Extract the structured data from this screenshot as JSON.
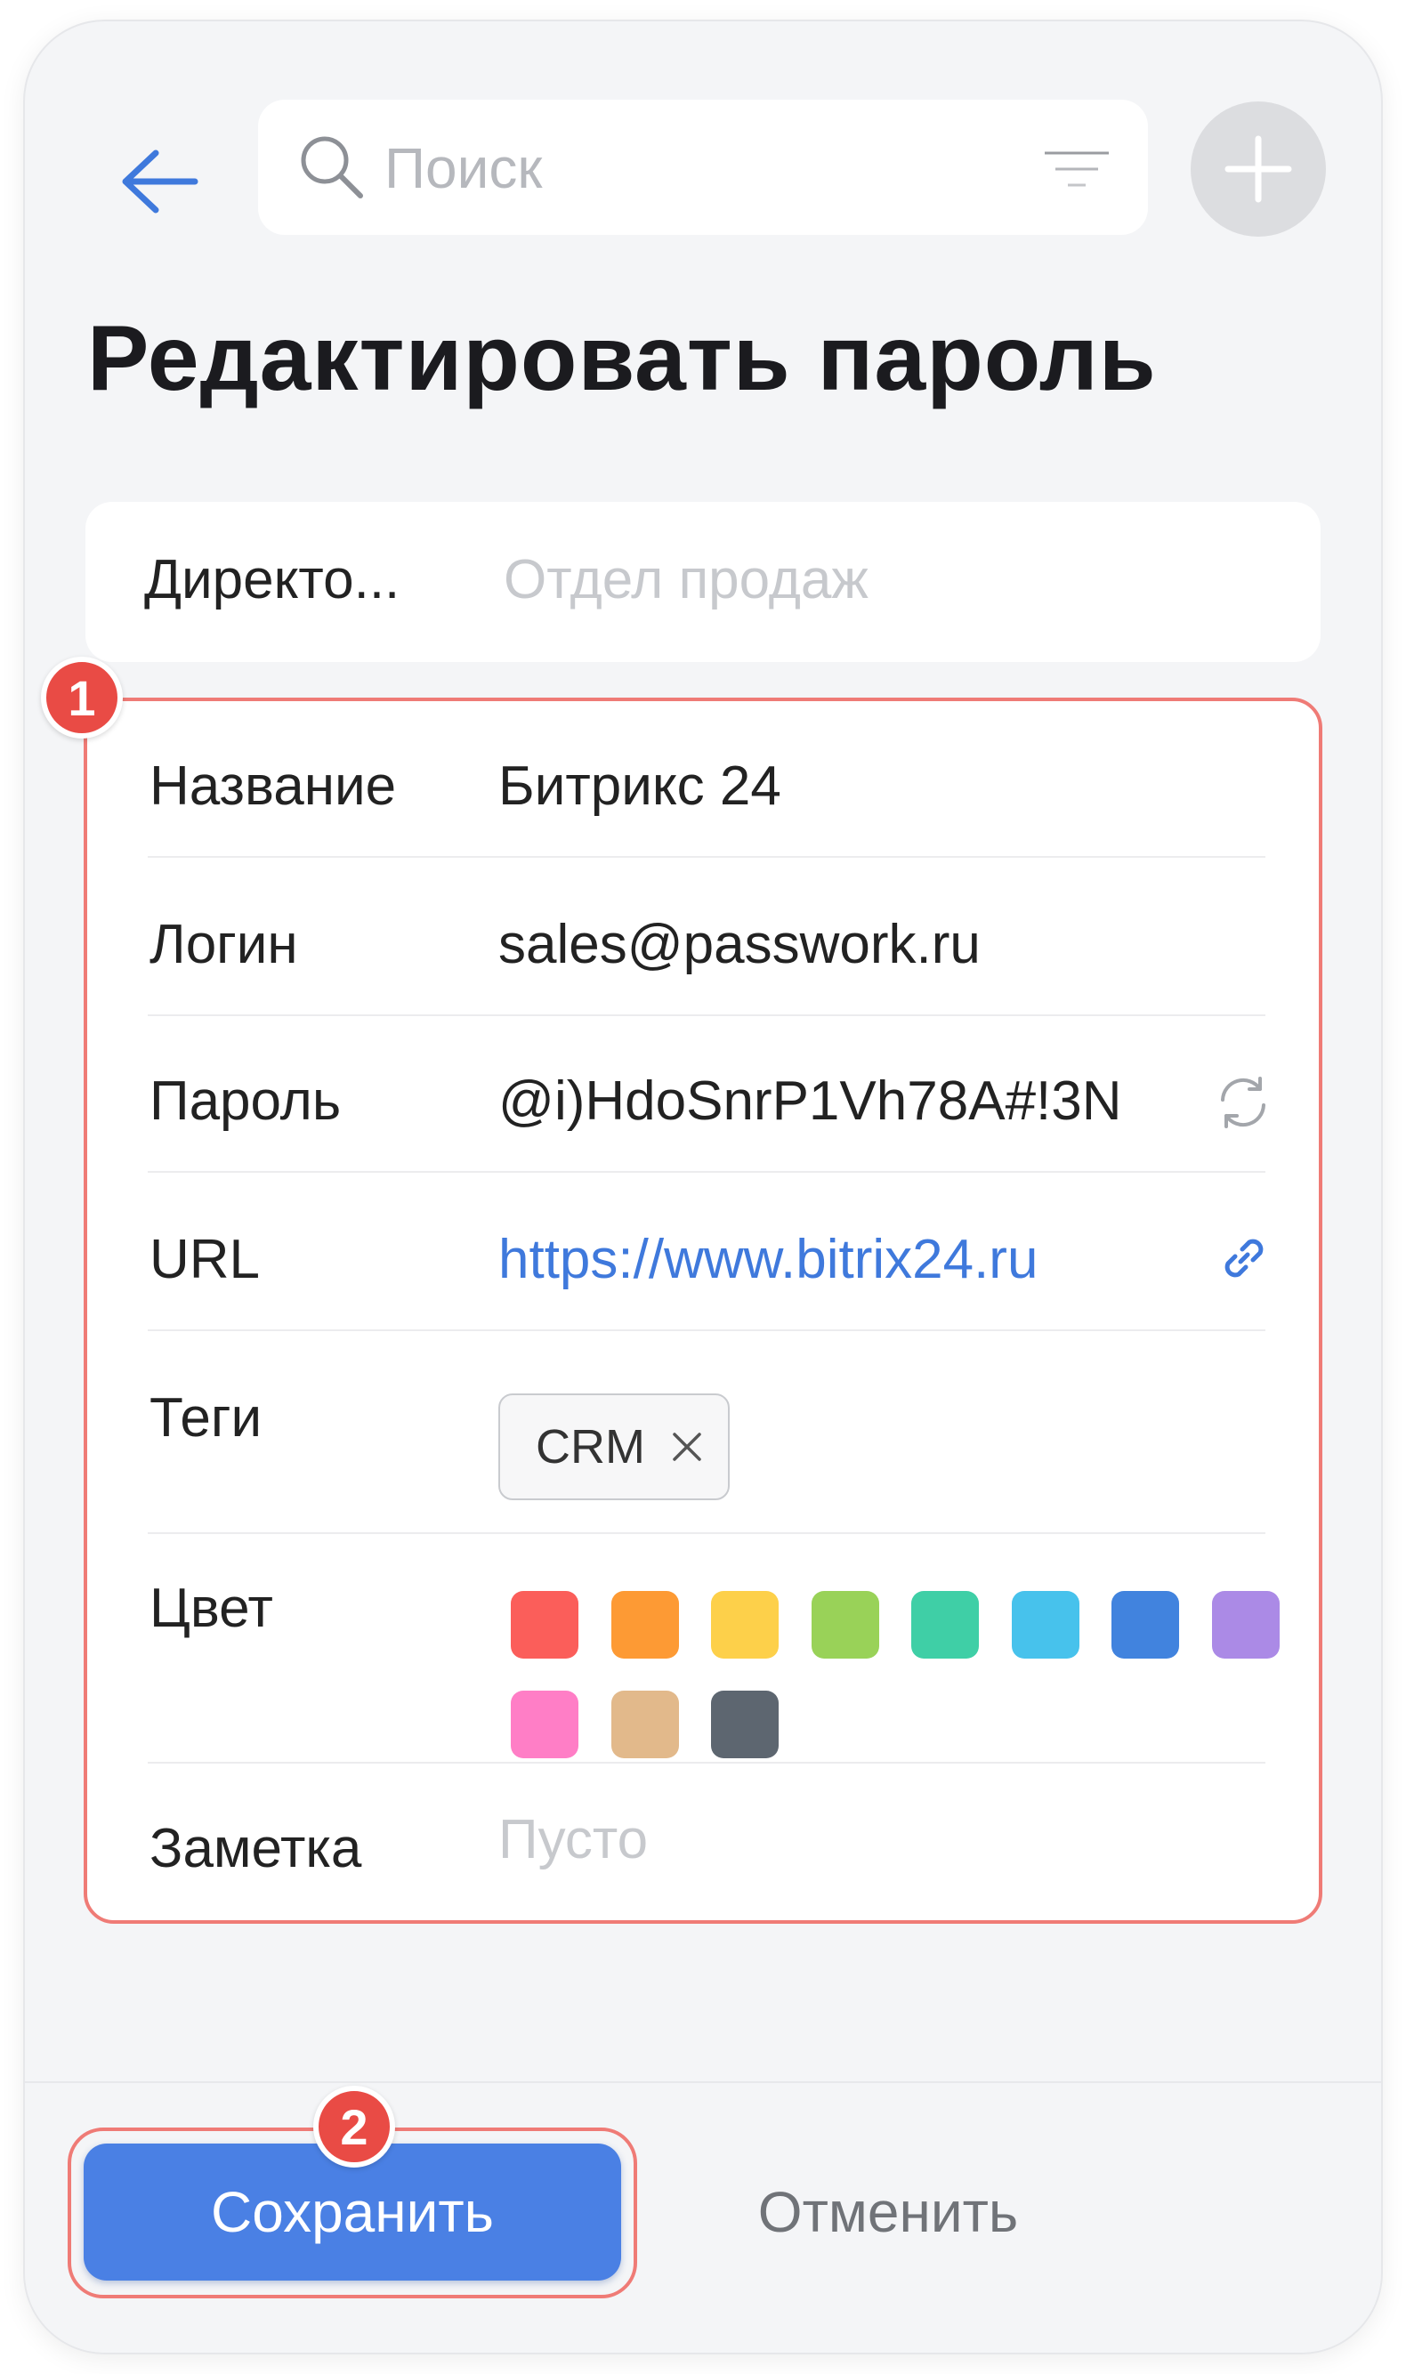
{
  "header": {
    "search_placeholder": "Поиск"
  },
  "page_title": "Редактировать пароль",
  "directory": {
    "label": "Директо...",
    "value": "Отдел продаж"
  },
  "annotations": {
    "badge_1": "1",
    "badge_2": "2"
  },
  "form": {
    "name": {
      "label": "Название",
      "value": "Битрикс 24"
    },
    "login": {
      "label": "Логин",
      "value": "sales@passwork.ru"
    },
    "password": {
      "label": "Пароль",
      "value": "@i)HdoSnrP1Vh78A#!3N"
    },
    "url": {
      "label": "URL",
      "value": "https://www.bitrix24.ru"
    },
    "tags": {
      "label": "Теги",
      "items": [
        "CRM"
      ]
    },
    "color": {
      "label": "Цвет",
      "swatches": [
        "#fb5e5a",
        "#fd9a34",
        "#fdd04a",
        "#99d258",
        "#3fcfa6",
        "#47c2ec",
        "#4183de",
        "#ab8ae6",
        "#ff7ec6",
        "#e2b98b",
        "#5d6670"
      ]
    },
    "note": {
      "label": "Заметка",
      "placeholder": "Пусто"
    }
  },
  "actions": {
    "save": "Сохранить",
    "cancel": "Отменить"
  }
}
